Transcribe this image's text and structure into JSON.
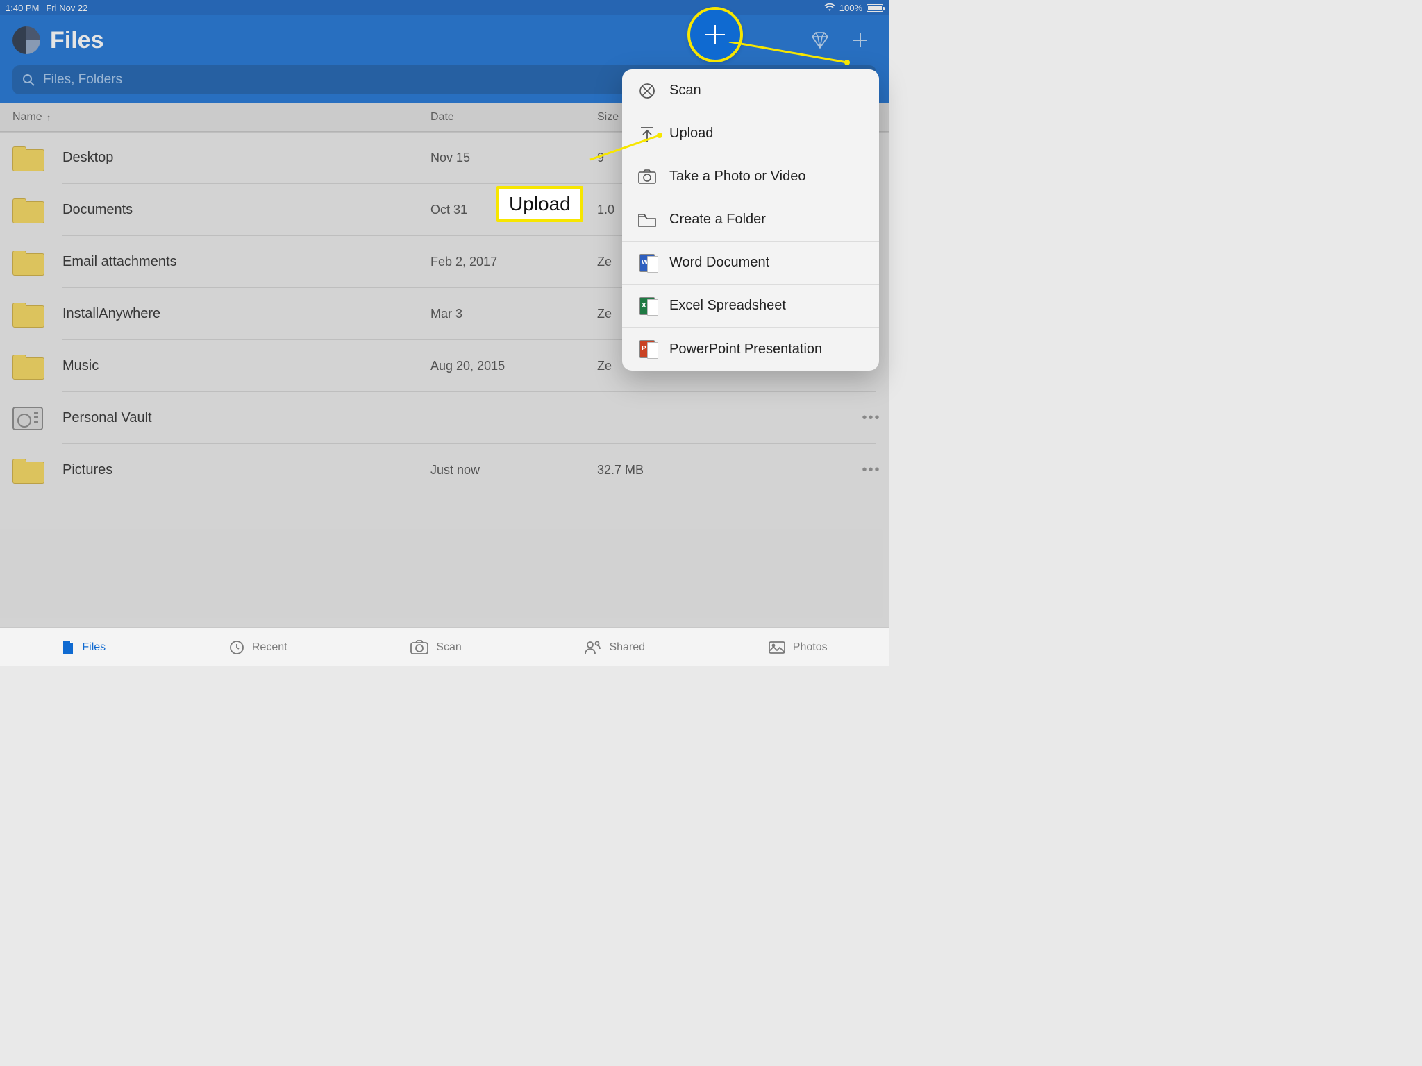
{
  "statusbar": {
    "time": "1:40 PM",
    "date": "Fri Nov 22",
    "battery": "100%"
  },
  "header": {
    "title": "Files"
  },
  "search": {
    "placeholder": "Files, Folders"
  },
  "columns": {
    "name": "Name",
    "date": "Date",
    "size": "Size"
  },
  "files": [
    {
      "name": "Desktop",
      "date": "Nov 15",
      "size": "9",
      "type": "folder",
      "more": false
    },
    {
      "name": "Documents",
      "date": "Oct 31",
      "size": "1.0",
      "type": "folder",
      "more": false
    },
    {
      "name": "Email attachments",
      "date": "Feb 2, 2017",
      "size": "Ze",
      "type": "folder",
      "more": false
    },
    {
      "name": "InstallAnywhere",
      "date": "Mar 3",
      "size": "Ze",
      "type": "folder",
      "more": false
    },
    {
      "name": "Music",
      "date": "Aug 20, 2015",
      "size": "Ze",
      "type": "folder",
      "more": false
    },
    {
      "name": "Personal Vault",
      "date": "",
      "size": "",
      "type": "vault",
      "more": true
    },
    {
      "name": "Pictures",
      "date": "Just now",
      "size": "32.7 MB",
      "type": "folder",
      "more": true
    }
  ],
  "add_menu": {
    "items": [
      {
        "id": "scan",
        "label": "Scan"
      },
      {
        "id": "upload",
        "label": "Upload"
      },
      {
        "id": "photo",
        "label": "Take a Photo or Video"
      },
      {
        "id": "folder",
        "label": "Create a Folder"
      },
      {
        "id": "word",
        "label": "Word Document"
      },
      {
        "id": "excel",
        "label": "Excel Spreadsheet"
      },
      {
        "id": "ppt",
        "label": "PowerPoint Presentation"
      }
    ]
  },
  "tabs": [
    {
      "id": "files",
      "label": "Files",
      "active": true
    },
    {
      "id": "recent",
      "label": "Recent",
      "active": false
    },
    {
      "id": "scan",
      "label": "Scan",
      "active": false
    },
    {
      "id": "shared",
      "label": "Shared",
      "active": false
    },
    {
      "id": "photos",
      "label": "Photos",
      "active": false
    }
  ],
  "callouts": {
    "upload_label": "Upload"
  }
}
